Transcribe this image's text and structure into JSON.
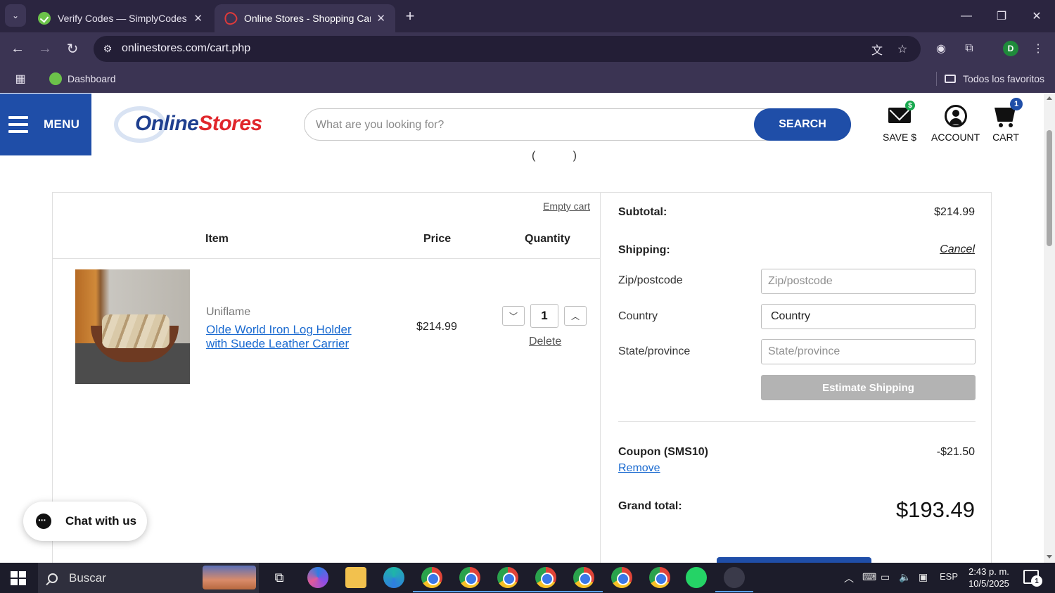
{
  "browser": {
    "tabs": [
      {
        "label": "Verify Codes — SimplyCodes",
        "active": false
      },
      {
        "label": "Online Stores - Shopping Cart",
        "active": true
      }
    ],
    "url": "onlinestores.com/cart.php",
    "profile_initial": "D",
    "bookmarks": [
      {
        "label": "Dashboard"
      }
    ],
    "all_bookmarks_label": "Todos los favoritos"
  },
  "header": {
    "menu_label": "MENU",
    "logo": {
      "part1": "Online",
      "part2": "Stores"
    },
    "search_placeholder": "What are you looking for?",
    "search_button": "SEARCH",
    "save_label": "SAVE $",
    "account_label": "ACCOUNT",
    "cart_label": "CART",
    "cart_count": "1"
  },
  "cart": {
    "empty_cart_label": "Empty cart",
    "columns": {
      "item": "Item",
      "price": "Price",
      "quantity": "Quantity"
    },
    "items": [
      {
        "brand": "Uniflame",
        "name": "Olde World Iron Log Holder with Suede Leather Carrier",
        "price": "$214.99",
        "quantity": "1",
        "delete_label": "Delete"
      }
    ]
  },
  "summary": {
    "subtotal_label": "Subtotal:",
    "subtotal_value": "$214.99",
    "shipping_label": "Shipping:",
    "cancel_label": "Cancel",
    "zip_label": "Zip/postcode",
    "zip_placeholder": "Zip/postcode",
    "country_label": "Country",
    "country_value": "Country",
    "state_label": "State/province",
    "state_placeholder": "State/province",
    "estimate_button": "Estimate Shipping",
    "coupon_label": "Coupon (SMS10)",
    "coupon_value": "-$21.50",
    "remove_label": "Remove",
    "grand_total_label": "Grand total:",
    "grand_total_value": "$193.49"
  },
  "chat": {
    "label": "Chat with us"
  },
  "taskbar": {
    "search_label": "Buscar",
    "language": "ESP",
    "time": "2:43 p. m.",
    "date": "10/5/2025",
    "notification_count": "1"
  }
}
